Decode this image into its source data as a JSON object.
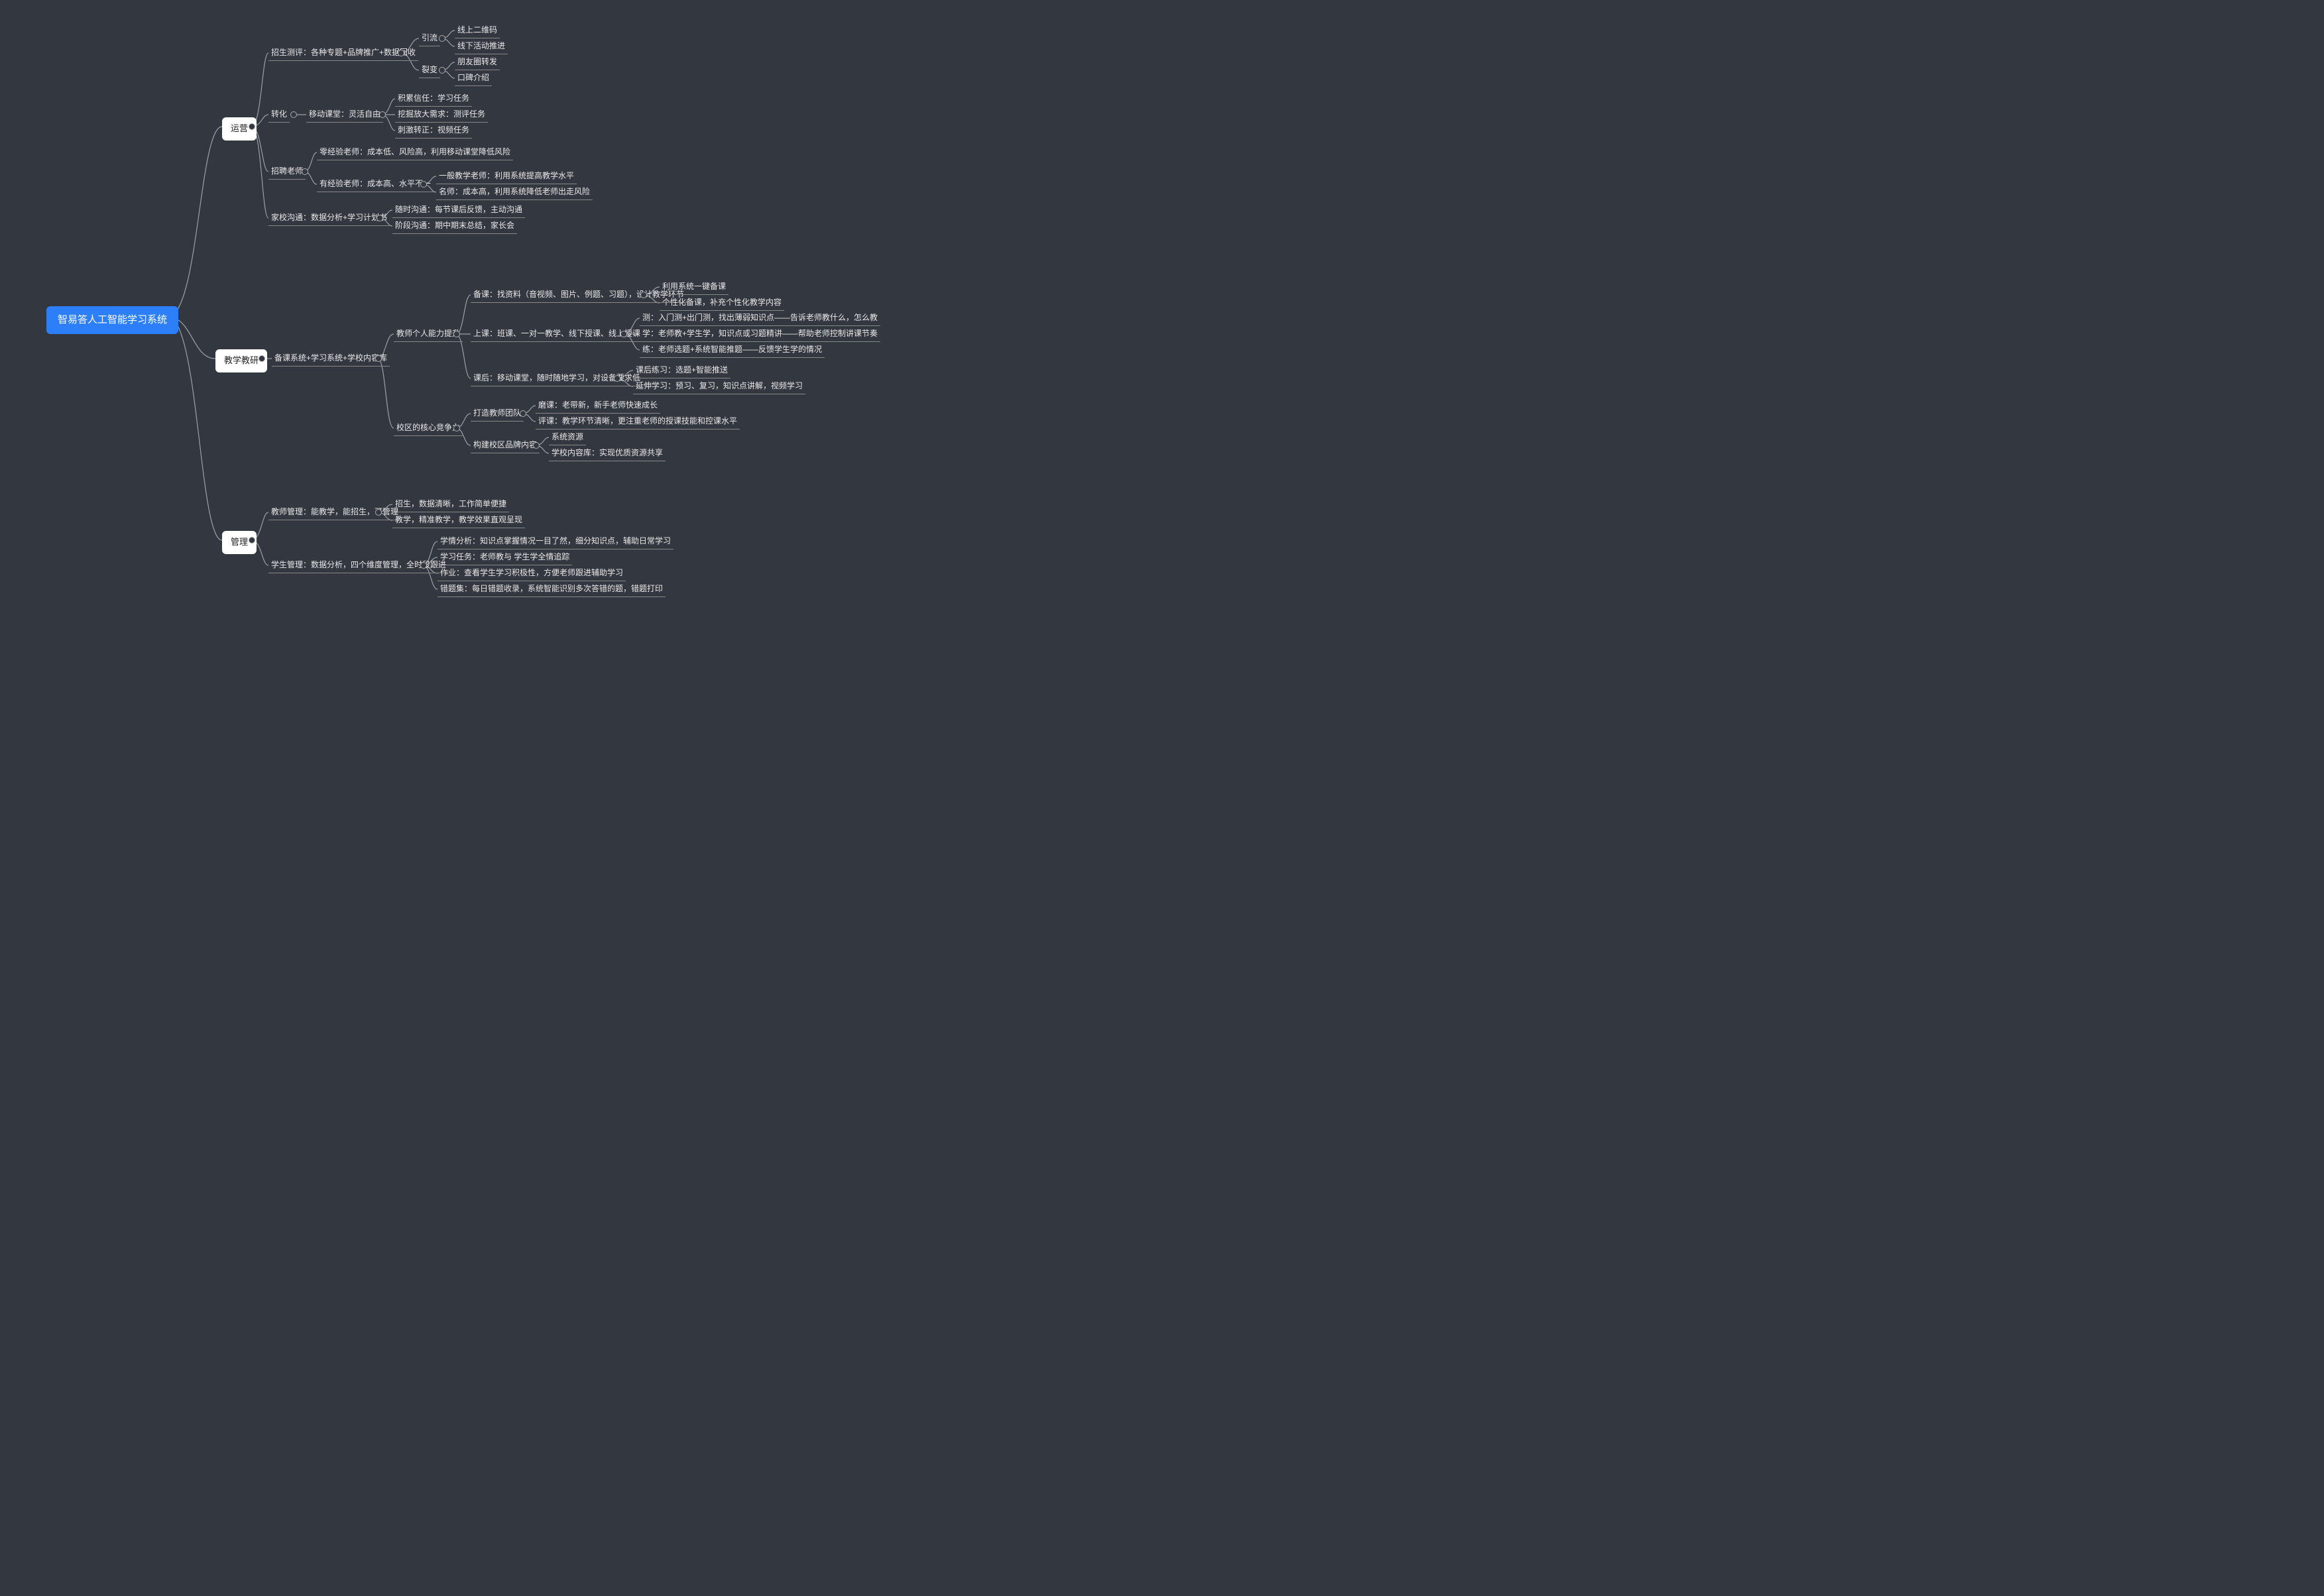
{
  "root": "智易答人工智能学习系统",
  "b1": {
    "label": "运营"
  },
  "b2": {
    "label": "教学教研"
  },
  "b3": {
    "label": "管理"
  },
  "op": {
    "n1": "招生测评：各种专题+品牌推广+数据回收",
    "n1a": "引流",
    "n1a1": "线上二维码",
    "n1a2": "线下活动推进",
    "n1b": "裂变",
    "n1b1": "朋友圈转发",
    "n1b2": "口碑介绍",
    "n2": "转化",
    "n2a": "移动课堂：灵活自由",
    "n2a1": "积累信任：学习任务",
    "n2a2": "挖掘放大需求：测评任务",
    "n2a3": "刺激转正：视频任务",
    "n3": "招聘老师",
    "n3a": "零经验老师：成本低、风险高，利用移动课堂降低风险",
    "n3b": "有经验老师：成本高、水平不一",
    "n3b1": "一般教学老师：利用系统提高教学水平",
    "n3b2": "名师：成本高，利用系统降低老师出走风险",
    "n4": "家校沟通：数据分析+学习计划书",
    "n4a": "随时沟通：每节课后反馈，主动沟通",
    "n4b": "阶段沟通：期中期末总结，家长会"
  },
  "te": {
    "n0": "备课系统+学习系统+学校内容库",
    "n1": "教师个人能力提升",
    "n1a": "备课：找资料（音视频、图片、例题、习题），设计教学环节",
    "n1a1": "利用系统一键备课",
    "n1a2": "个性化备课，补充个性化教学内容",
    "n1b": "上课：班课、一对一教学、线下授课、线上授课",
    "n1b1": "测：入门测+出门测，找出薄弱知识点——告诉老师教什么，怎么教",
    "n1b2": "学：老师教+学生学，知识点或习题精讲——帮助老师控制讲课节奏",
    "n1b3": "练：老师选题+系统智能推题——反馈学生学的情况",
    "n1c": "课后：移动课堂，随时随地学习，对设备要求低",
    "n1c1": "课后练习：选题+智能推送",
    "n1c2": "延伸学习：预习、复习，知识点讲解，视频学习",
    "n2": "校区的核心竞争力",
    "n2a": "打造教师团队",
    "n2a1": "磨课：老带新，新手老师快速成长",
    "n2a2": "评课：教学环节清晰，更注重老师的授课技能和控课水平",
    "n2b": "构建校区品牌内容",
    "n2b1": "系统资源",
    "n2b2": "学校内容库：实现优质资源共享"
  },
  "mg": {
    "n1": "教师管理：能教学，能招生，可管理",
    "n1a": "招生，数据清晰，工作简单便捷",
    "n1b": "教学，精准教学，教学效果直观呈现",
    "n2": "学生管理：数据分析，四个维度管理，全时段跟进",
    "n2a": "学情分析：知识点掌握情况一目了然，细分知识点，辅助日常学习",
    "n2b": "学习任务：老师教与 学生学全情追踪",
    "n2c": "作业：查看学生学习积极性，方便老师跟进辅助学习",
    "n2d": "错题集：每日错题收录，系统智能识别多次答错的题，错题打印"
  }
}
